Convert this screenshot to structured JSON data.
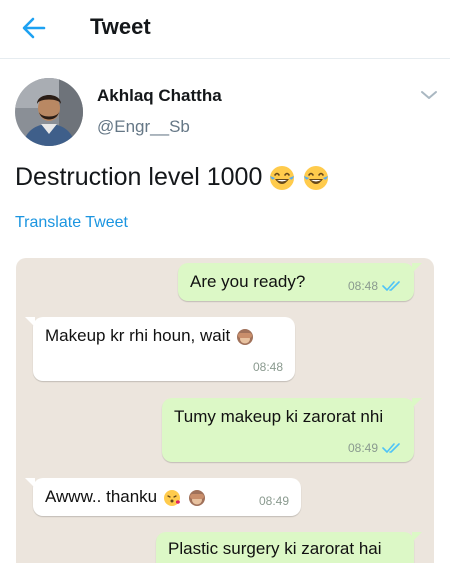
{
  "header": {
    "title": "Tweet",
    "back_icon": "arrow-left-icon",
    "accent": "#1da1f2"
  },
  "tweet": {
    "author_name": "Akhlaq Chattha",
    "author_handle": "@Engr__Sb",
    "text": "Destruction level 1000",
    "emoji": "face-with-tears-of-joy",
    "translate_label": "Translate Tweet",
    "link_color": "#1b95e0"
  },
  "chat": {
    "messages": [
      {
        "side": "outgoing",
        "text": "Are you ready?",
        "time": "08:48",
        "read": true
      },
      {
        "side": "incoming",
        "text": "Makeup kr rhi houn, wait",
        "emoji": "see-no-evil-monkey",
        "time": "08:48"
      },
      {
        "side": "outgoing",
        "text": "Tumy makeup ki zarorat nhi",
        "time": "08:49",
        "read": true
      },
      {
        "side": "incoming",
        "text": "Awww.. thanku",
        "emoji": "kissing-face see-no-evil-monkey",
        "time": "08:49"
      },
      {
        "side": "outgoing",
        "text": "Plastic surgery ki zarorat hai"
      }
    ],
    "outgoing_color": "#dcf8c6",
    "incoming_color": "#ffffff",
    "background": "#ece5dd"
  }
}
